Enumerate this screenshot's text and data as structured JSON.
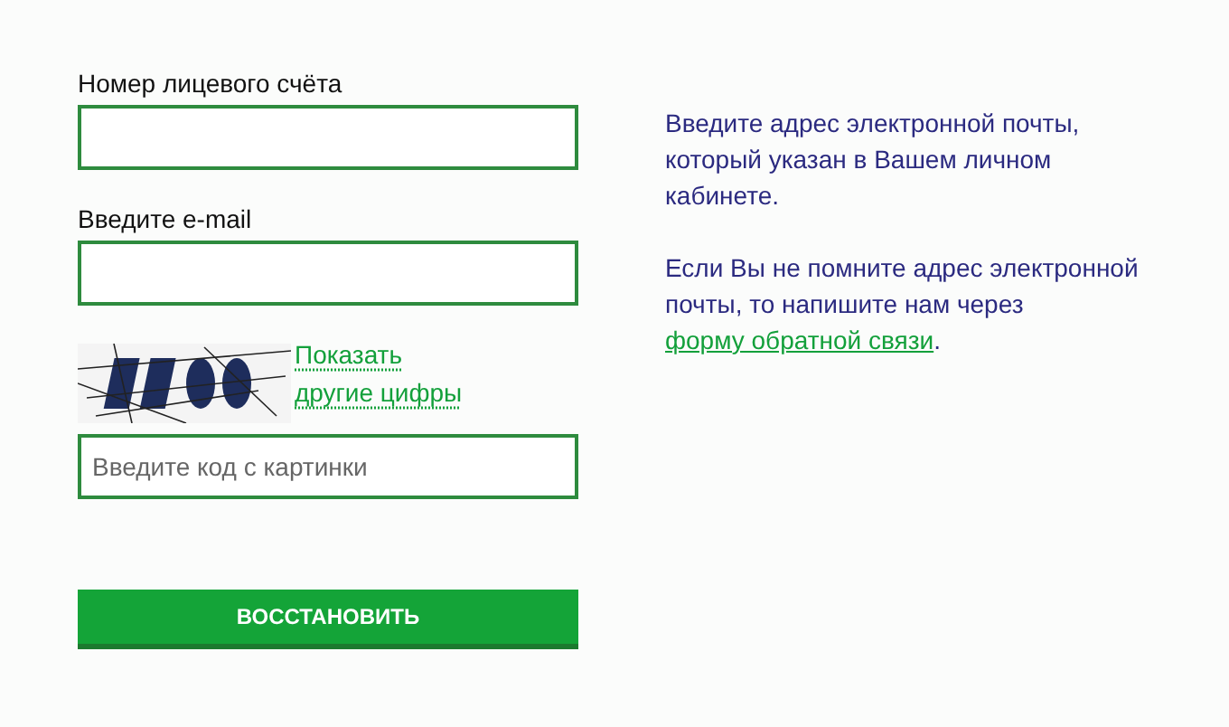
{
  "fields": [
    {
      "label": "Номер лицевого счёта"
    },
    {
      "label": "Введите e-mail"
    }
  ],
  "captcha": {
    "kind": "picture",
    "refresh_link": "Показать другие цифры",
    "input": {
      "placeholder": "Введите код с картинки"
    }
  },
  "submit_button": "ВОССТАНОВИТЬ",
  "info": {
    "paragraph_1": "Введите адрес электронной почты, который указан в Вашем личном кабинете.",
    "paragraph_2": "Если Вы не помните адрес электронной почты, то напишите нам через",
    "link": "форму обратной связи",
    "tail": "."
  }
}
